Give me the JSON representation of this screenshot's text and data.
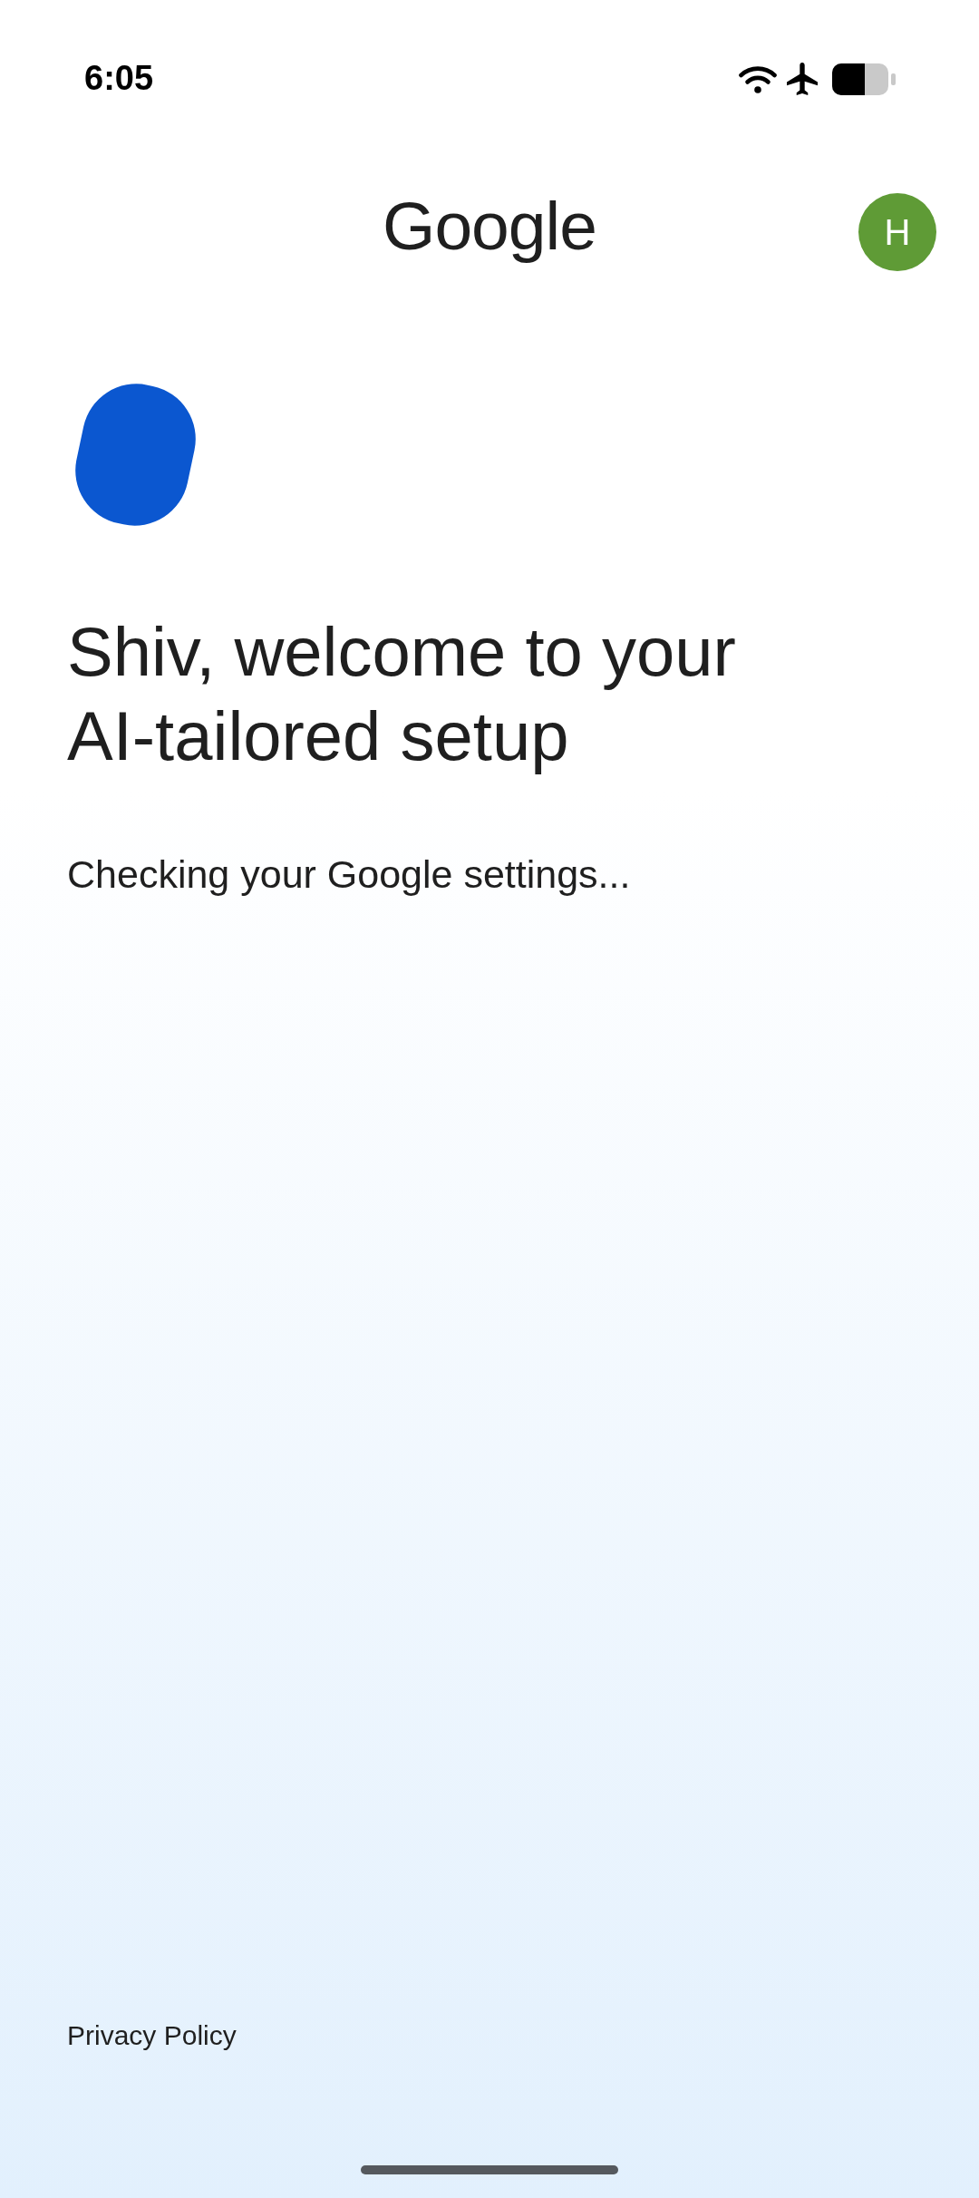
{
  "status_bar": {
    "time": "6:05"
  },
  "header": {
    "logo": "Google",
    "avatar": {
      "initial": "H"
    }
  },
  "heading": "Shiv, welcome to your AI-tailored setup",
  "status_message": "Checking your Google settings...",
  "footer": {
    "link": "Privacy Policy"
  }
}
